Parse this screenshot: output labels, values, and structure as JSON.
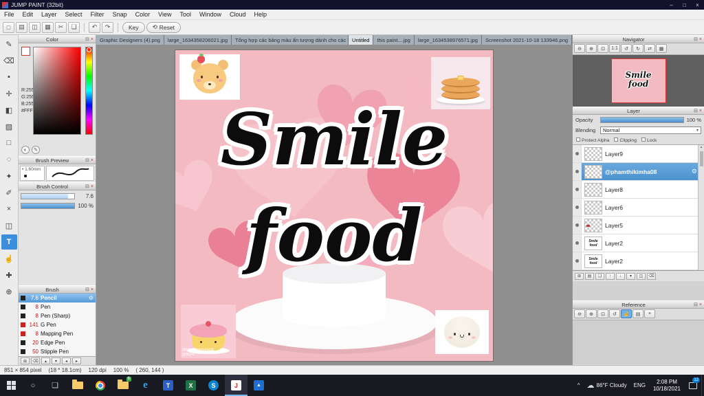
{
  "titlebar": {
    "title": "JUMP PAINT (32bit)"
  },
  "menu": {
    "items": [
      "File",
      "Edit",
      "Layer",
      "Select",
      "Filter",
      "Snap",
      "Color",
      "View",
      "Tool",
      "Window",
      "Cloud",
      "Help"
    ]
  },
  "toolbar": {
    "key": "Key",
    "reset": "Reset"
  },
  "tabs": [
    {
      "label": "Graphic Designers (4).png"
    },
    {
      "label": "large_1634358206021.jpg"
    },
    {
      "label": "Tổng hợp các bảng màu ấn tượng dành cho các bạn luyện vẽ.png"
    },
    {
      "label": "Untitled"
    },
    {
      "label": "this paint....jpg"
    },
    {
      "label": "large_1634538976571.jpg"
    },
    {
      "label": "Screenshot 2021-10-18 133946.png"
    }
  ],
  "color_panel": {
    "title": "Color",
    "r": "R:255",
    "g": "G:255",
    "b": "B:255",
    "hex": "#FFFFFF"
  },
  "brush_preview": {
    "title": "Brush Preview",
    "size": "1.60mm"
  },
  "brush_control": {
    "title": "Brush Control",
    "size_value": "7.6",
    "opacity_value": "100 %"
  },
  "brush_panel": {
    "title": "Brush",
    "brushes": [
      {
        "size": "7.6",
        "name": "Pencil"
      },
      {
        "size": "8",
        "name": "Pen"
      },
      {
        "size": "8",
        "name": "Pen (Sharp)"
      },
      {
        "size": "141",
        "name": "G Pen"
      },
      {
        "size": "8",
        "name": "Mapping Pen"
      },
      {
        "size": "20",
        "name": "Edge Pen"
      },
      {
        "size": "50",
        "name": "Stipple Pen"
      }
    ]
  },
  "navigator": {
    "title": "Navigator",
    "thumb_line1": "Smile",
    "thumb_line2": "food"
  },
  "layer_panel": {
    "title": "Layer",
    "opacity_label": "Opacity",
    "opacity_value": "100 %",
    "blending_label": "Blending",
    "blending_value": "Normal",
    "protect_alpha": "Protect Alpha",
    "clipping": "Clipping",
    "lock": "Lock",
    "layers": [
      {
        "name": "Layer9"
      },
      {
        "name": "@phamthikimha08"
      },
      {
        "name": "Layer8"
      },
      {
        "name": "Layer6"
      },
      {
        "name": "Layer5"
      },
      {
        "name": "Layer2",
        "thumb_text": "Smile food"
      },
      {
        "name": "Layer2",
        "thumb_text": "Smile food"
      }
    ]
  },
  "reference": {
    "title": "Reference"
  },
  "canvas": {
    "text_line1": "Smile",
    "text_line2": "food",
    "watermark1": "@phamthikimha08",
    "watermark2": "@fb247"
  },
  "statusbar": {
    "size": "851 × 854 pixel",
    "dimensions": "(18 * 18.1cm)",
    "dpi": "120 dpi",
    "zoom": "100 %",
    "coords": "( 260, 144 )"
  },
  "taskbar": {
    "weather": "86°F Cloudy",
    "language": "ENG",
    "time": "2:08 PM",
    "date": "10/18/2021",
    "notif_count": "12",
    "folder_badge": "6",
    "edge_label": "e",
    "excel_label": "X",
    "skype_label": "S",
    "jump_label": "J",
    "photos_label": "▲"
  },
  "colors": {
    "accent_blue": "#3e8ede",
    "selection_blue": "#4d92cf",
    "canvas_pink": "#f3bac2",
    "heart_dark": "#ec8498",
    "taskbar_bg": "#191922"
  },
  "icons": {
    "min": "–",
    "max": "□",
    "close": "×",
    "panel_collapse": "⊟",
    "panel_close": "×",
    "gear": "⚙",
    "caret_down": "▾",
    "undo": "↶",
    "redo": "↷",
    "reset_arrow": "⟲",
    "search_circle": "○",
    "task_view": "❏",
    "tray_arrow": "^",
    "cloud": "☁",
    "bullet": "•",
    "toolbar_file": [
      "□",
      "▤",
      "◫",
      "▦",
      "✂",
      "❏"
    ],
    "toolstrip": [
      "✎",
      "⌫",
      "▪",
      "✛",
      "◧",
      "▨",
      "□",
      "◌",
      "✦",
      "✐",
      "×",
      "◫",
      "T",
      "☝",
      "✚",
      "⊕"
    ],
    "navigator_btns": [
      "⊖",
      "⊕",
      "⊡",
      "1:1",
      "↺",
      "↻",
      "⇄",
      "▦"
    ],
    "layer_btns": [
      "⊞",
      "▤",
      "❏",
      "↑",
      "↓",
      "▾",
      "◫",
      "⌫"
    ],
    "reference_btns": [
      "⊖",
      "⊕",
      "⊡",
      "↺",
      "☝",
      "▤",
      "×"
    ],
    "brush_btns": [
      "⊞",
      "⌫",
      "▴",
      "▾",
      "◂",
      "▸"
    ],
    "color_btns": [
      "◐",
      "✎"
    ]
  }
}
